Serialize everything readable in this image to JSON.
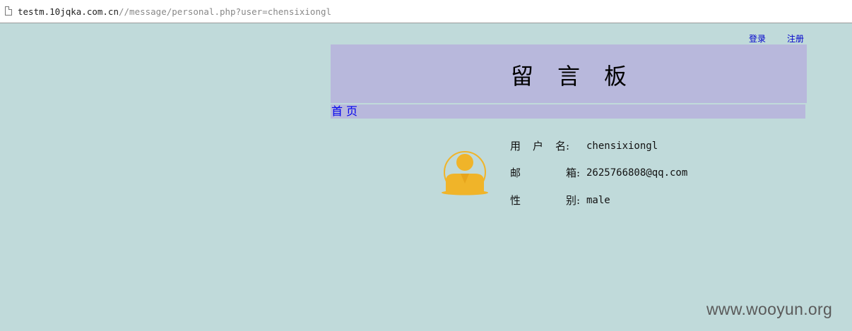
{
  "browser": {
    "url_host": "testm.10jqka.com.cn",
    "url_path": "//message/personal.php?user=chensixiongl"
  },
  "header_links": {
    "login": "登录",
    "register": "注册"
  },
  "banner": {
    "title": "留言板"
  },
  "nav": {
    "home": "首页"
  },
  "profile": {
    "username_label": [
      "用",
      "户",
      "名:"
    ],
    "username": "chensixiongl",
    "email_label": [
      "邮",
      "箱:"
    ],
    "email": "2625766808@qq.com",
    "gender_label": [
      "性",
      "别:"
    ],
    "gender": "male"
  },
  "colors": {
    "page_bg": "#c0dada",
    "banner_bg": "#b8b8dc",
    "link": "#0000ee",
    "avatar": "#f0b429"
  },
  "watermark": "www.wooyun.org"
}
